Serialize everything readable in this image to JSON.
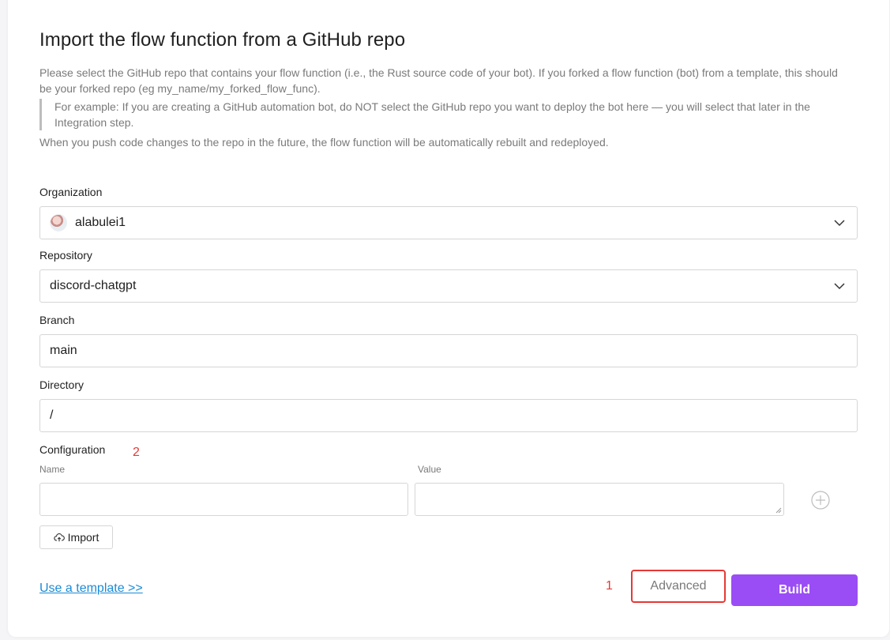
{
  "page": {
    "title": "Import the flow function from a GitHub repo",
    "description": "Please select the GitHub repo that contains your flow function (i.e., the Rust source code of your bot). If you forked a flow function (bot) from a template, this should be your forked repo (eg my_name/my_forked_flow_func).",
    "example_note": "For example: If you are creating a GitHub automation bot, do NOT select the GitHub repo you want to deploy the bot here — you will select that later in the Integration step.",
    "redeploy_note": "When you push code changes to the repo in the future, the flow function will be automatically rebuilt and redeployed."
  },
  "form": {
    "organization": {
      "label": "Organization",
      "value": "alabulei1",
      "icon": "avatar-image"
    },
    "repository": {
      "label": "Repository",
      "value": "discord-chatgpt",
      "icon": "chevron-down-icon"
    },
    "branch": {
      "label": "Branch",
      "value": "main"
    },
    "directory": {
      "label": "Directory",
      "value": "/"
    },
    "configuration": {
      "label": "Configuration",
      "name_label": "Name",
      "value_label": "Value",
      "name_value": "",
      "value_value": "",
      "add_icon": "plus-circle-icon",
      "import_label": "Import",
      "import_icon": "cloud-upload-icon"
    }
  },
  "footer": {
    "template_link": "Use a template >>",
    "advanced_label": "Advanced",
    "build_label": "Build"
  },
  "annotations": {
    "one": "1",
    "two": "2",
    "color": "#e53935"
  },
  "colors": {
    "accent": "#9a4cf5",
    "link": "#1b8bd6"
  }
}
